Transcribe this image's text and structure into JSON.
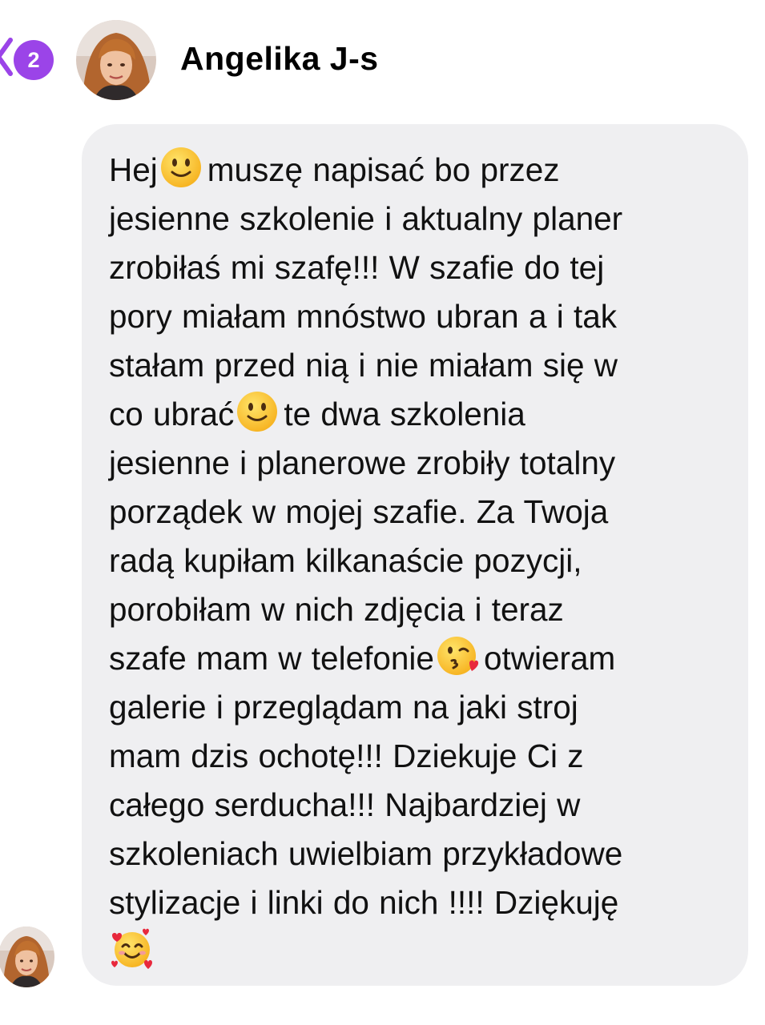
{
  "header": {
    "unread_count": "2",
    "contact_name": "Angelika J-s",
    "accent_color": "#9b44e8"
  },
  "message": {
    "bubble_color": "#efeff1",
    "lines": [
      {
        "before": "Hej",
        "emoji": "slightly-smiling-face",
        "after": "muszę napisać bo przez"
      },
      {
        "text": "jesienne szkolenie i aktualny planer"
      },
      {
        "text": "zrobiłaś mi szafę!!! W szafie do tej"
      },
      {
        "text": "pory miałam mnóstwo ubran a i tak"
      },
      {
        "text": "stałam przed nią i nie miałam się w"
      },
      {
        "before": "co ubrać",
        "emoji": "slightly-smiling-face",
        "after": "te dwa szkolenia"
      },
      {
        "text": "jesienne i planerowe zrobiły totalny"
      },
      {
        "text": "porządek w mojej szafie. Za Twoja"
      },
      {
        "text": "radą kupiłam kilkanaście pozycji,"
      },
      {
        "text": "porobiłam w nich zdjęcia i teraz"
      },
      {
        "before": "szafe mam w telefonie",
        "emoji": "face-blowing-a-kiss",
        "after": "otwieram"
      },
      {
        "text": "galerie i przeglądam na jaki stroj"
      },
      {
        "text": "mam dzis ochotę!!! Dziekuje Ci z"
      },
      {
        "text": "całego serducha!!! Najbardziej w"
      },
      {
        "text": "szkoleniach uwielbiam przykładowe"
      },
      {
        "text": "stylizacje i linki do nich !!!! Dziękuję"
      },
      {
        "emoji": "smiling-face-with-hearts"
      }
    ]
  }
}
